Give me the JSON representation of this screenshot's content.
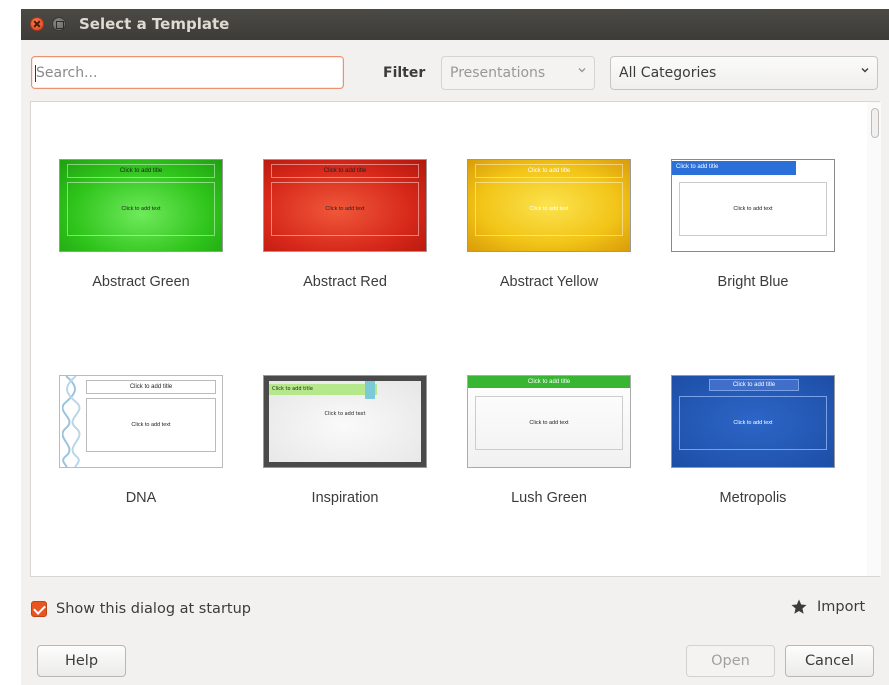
{
  "window": {
    "title": "Select a Template"
  },
  "search": {
    "placeholder": "Search...",
    "value": ""
  },
  "filter": {
    "label": "Filter",
    "type_selected": "Presentations",
    "category_selected": "All Categories"
  },
  "templates": [
    {
      "name": "Abstract Green",
      "thumb_title": "Click to add title",
      "thumb_text": "Click to add text"
    },
    {
      "name": "Abstract Red",
      "thumb_title": "Click to add title",
      "thumb_text": "Click to add text"
    },
    {
      "name": "Abstract Yellow",
      "thumb_title": "Click to add title",
      "thumb_text": "Click to add text"
    },
    {
      "name": "Bright Blue",
      "thumb_title": "Click to add title",
      "thumb_text": "Click to add text"
    },
    {
      "name": "DNA",
      "thumb_title": "Click to add title",
      "thumb_text": "Click to add text"
    },
    {
      "name": "Inspiration",
      "thumb_title": "Click to add title",
      "thumb_text": "Click to add text"
    },
    {
      "name": "Lush Green",
      "thumb_title": "Click to add title",
      "thumb_text": "Click to add text"
    },
    {
      "name": "Metropolis",
      "thumb_title": "Click to add title",
      "thumb_text": "Click to add text"
    }
  ],
  "footer": {
    "show_at_startup_label": "Show this dialog at startup",
    "show_at_startup_checked": true,
    "import_label": "Import",
    "help_label": "Help",
    "open_label": "Open",
    "cancel_label": "Cancel"
  },
  "colors": {
    "accent": "#e95420",
    "titlebar": "#3d3c38"
  }
}
